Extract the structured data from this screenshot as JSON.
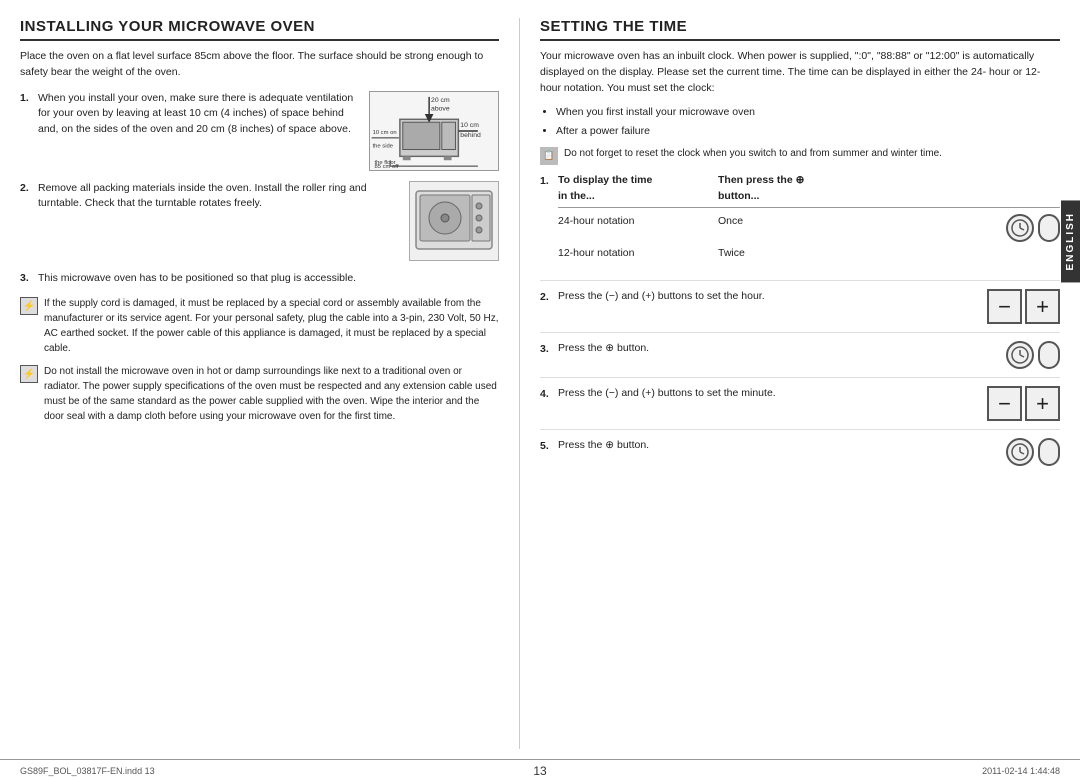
{
  "left": {
    "title": "INSTALLING YOUR MICROWAVE OVEN",
    "intro": "Place the oven on a flat level surface 85cm above the floor. The surface should be strong enough to safety bear the weight of the oven.",
    "steps": [
      {
        "num": "1.",
        "text": "When you install your oven, make sure there is adequate ventilation for your oven by leaving at least 10 cm (4 inches) of space behind and, on the sides of the oven and 20 cm (8 inches) of space above.",
        "has_diagram": true
      },
      {
        "num": "2.",
        "text": "Remove all packing materials inside the oven. Install the roller ring and turntable. Check that the turntable rotates freely.",
        "has_turntable": true
      },
      {
        "num": "3.",
        "text": "This microwave oven has to be positioned so that plug is accessible.",
        "has_turntable": false
      }
    ],
    "warnings": [
      {
        "text": "If the supply cord is damaged, it must be replaced by a special cord or assembly available from the manufacturer or its service agent. For your personal safety, plug the cable into a 3-pin, 230 Volt, 50 Hz, AC earthed socket. If the power cable of this appliance is damaged, it must be replaced by a special cable."
      },
      {
        "text": "Do not install the microwave oven in hot or damp surroundings like next to a traditional oven or radiator. The power supply specifications of the oven must be respected and any extension cable used must be of the same standard as the power cable supplied with the oven. Wipe the interior and the door seal with a damp cloth before using your microwave oven for the first time."
      }
    ],
    "diagram_labels": {
      "above": "20 cm above",
      "behind": "10 cm behind",
      "floor": "85 cm off the floor",
      "side": "10 cm on the side"
    }
  },
  "right": {
    "title": "SETTING THE TIME",
    "intro": "Your microwave oven has an inbuilt clock. When power is supplied, \":0\", \"88:88\" or \"12:00\" is automatically displayed on the display. Please set the current time. The time can be displayed in either the 24- hour or 12-hour notation. You must set the clock:",
    "bullets": [
      "When you first install your microwave oven",
      "After a power failure"
    ],
    "note": "Do not forget to reset the clock when you switch to and from summer and winter time.",
    "steps": [
      {
        "num": "1.",
        "col1_header": "To display the time in the...",
        "col2_header": "Then press the ⊕ button...",
        "rows": [
          {
            "col1": "24-hour notation",
            "col2": "Once"
          },
          {
            "col1": "12-hour notation",
            "col2": "Twice"
          }
        ]
      },
      {
        "num": "2.",
        "text": "Press the (−) and (+) buttons to set the hour.",
        "type": "pm"
      },
      {
        "num": "3.",
        "text": "Press the ⊕ button.",
        "type": "clock"
      },
      {
        "num": "4.",
        "text": "Press the (−) and (+) buttons to set the minute.",
        "type": "pm"
      },
      {
        "num": "5.",
        "text": "Press the ⊕ button.",
        "type": "clock"
      }
    ]
  },
  "sidebar": {
    "label": "ENGLISH"
  },
  "footer": {
    "page_num": "13",
    "left_text": "GS89F_BOL_03817F-EN.indd  13",
    "right_text": "2011-02-14   1:44:48"
  }
}
